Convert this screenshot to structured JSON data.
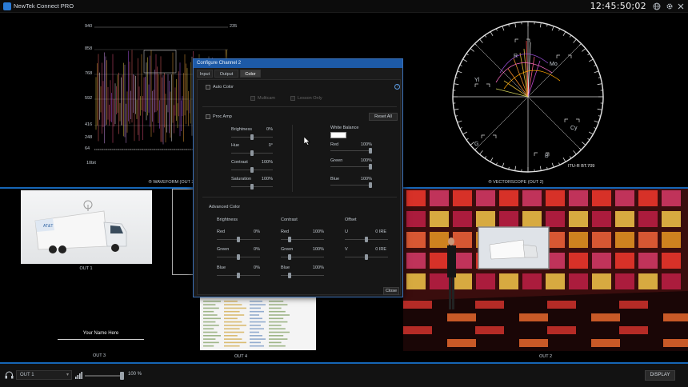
{
  "app": {
    "title": "NewTek Connect PRO",
    "clock": "12:45:50;02"
  },
  "titlebar_icons": [
    "globe-icon",
    "gear-icon",
    "close-icon"
  ],
  "waveform": {
    "label": "® WAVEFORM (OUT 2)",
    "left_scale": [
      "940",
      "858",
      "768",
      "592",
      "416",
      "248",
      "64"
    ],
    "right_scale": [
      "235",
      "",
      "",
      "",
      "",
      ""
    ],
    "bottom_label": "10bit"
  },
  "vectorscope": {
    "label": "® VECTORSCOPE (OUT 2)",
    "standard": "ITU-R BT.709",
    "targets": [
      "R",
      "Mo",
      "Yl",
      "G",
      "Cy",
      "B"
    ]
  },
  "outputs": {
    "out1": {
      "label": "OUT 1"
    },
    "out2": {
      "label": "OUT 2"
    },
    "out3": {
      "label": "OUT 3",
      "lower_third": "Your Name Here"
    },
    "out4": {
      "label": "OUT 4"
    }
  },
  "dialog": {
    "title": "Configure Channel 2",
    "tabs": [
      "Input",
      "Output",
      "Color"
    ],
    "active_tab": "Color",
    "auto_color": {
      "label": "Auto Color",
      "multicam": "Multicam",
      "lesson": "Lesson Only"
    },
    "proc_amp": {
      "label": "Proc Amp",
      "reset": "Reset All",
      "brightness": {
        "label": "Brightness",
        "value": "0%",
        "level": 0.5
      },
      "hue": {
        "label": "Hue",
        "value": "0°",
        "level": 0.5
      },
      "contrast": {
        "label": "Contrast",
        "value": "100%",
        "level": 0.5
      },
      "saturation": {
        "label": "Saturation",
        "value": "100%",
        "level": 0.5
      }
    },
    "white_balance": {
      "label": "White Balance",
      "red": {
        "label": "Red",
        "value": "100%",
        "level": 1.0
      },
      "green": {
        "label": "Green",
        "value": "100%",
        "level": 1.0
      },
      "blue": {
        "label": "Blue",
        "value": "100%",
        "level": 1.0
      }
    },
    "advanced": {
      "label": "Advanced Color",
      "col_brightness": "Brightness",
      "col_contrast": "Contrast",
      "col_offset": "Offset",
      "b_red": {
        "label": "Red",
        "value": "0%"
      },
      "b_green": {
        "label": "Green",
        "value": "0%"
      },
      "b_blue": {
        "label": "Blue",
        "value": "0%"
      },
      "c_red": {
        "label": "Red",
        "value": "100%"
      },
      "c_green": {
        "label": "Green",
        "value": "100%"
      },
      "c_blue": {
        "label": "Blue",
        "value": "100%"
      },
      "o_u": {
        "label": "U",
        "value": "0 IRE"
      },
      "o_v": {
        "label": "V",
        "value": "0 IRE"
      }
    },
    "close": "Close"
  },
  "bottombar": {
    "output_select": "OUT 1",
    "volume": "100 %",
    "volume_level": 1.0,
    "display_button": "DISPLAY"
  },
  "colors": {
    "accent": "#1d5aa7",
    "divider": "#1666b6"
  }
}
